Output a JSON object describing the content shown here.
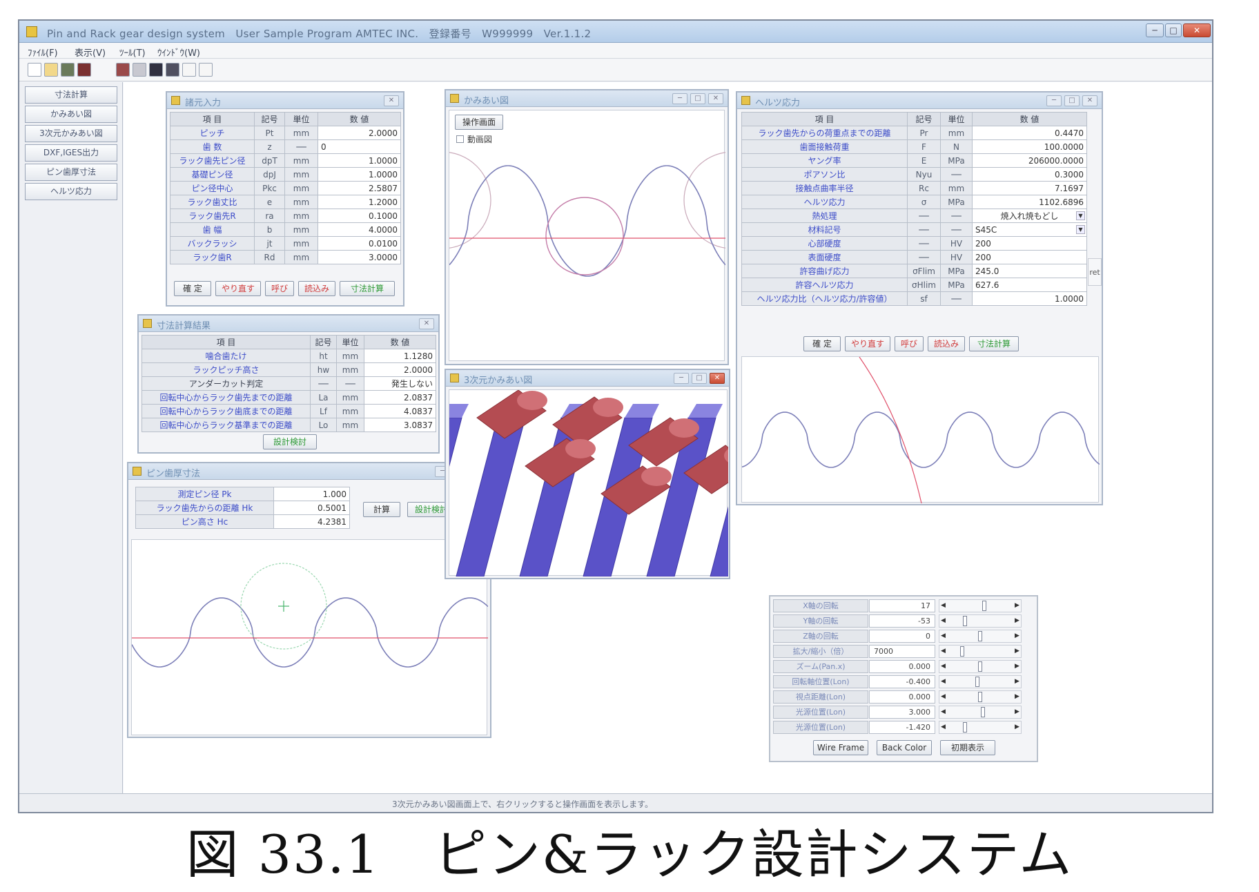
{
  "window": {
    "title": "Pin and Rack gear design system　User Sample Program AMTEC INC.　登録番号　W999999　Ver.1.1.2"
  },
  "menu": [
    "ﾌｧｲﾙ(F)",
    "表示(V)",
    "ﾂｰﾙ(T)",
    "ｳｲﾝﾄﾞｳ(W)"
  ],
  "nav_buttons": [
    "寸法計算",
    "かみあい図",
    "3次元かみあい図",
    "DXF,IGES出力",
    "ピン歯厚寸法",
    "ヘルツ応力"
  ],
  "basic_input": {
    "title": "諸元入力",
    "headers": [
      "項 目",
      "記号",
      "単位",
      "数 値"
    ],
    "rows": [
      {
        "label": "ピッチ",
        "sym": "Pt",
        "unit": "mm",
        "val": "2.0000"
      },
      {
        "label": "歯 数",
        "sym": "z",
        "unit": "──",
        "val": "0"
      },
      {
        "label": "ラック歯先ピン径",
        "sym": "dpT",
        "unit": "mm",
        "val": "1.0000"
      },
      {
        "label": "基礎ピン径",
        "sym": "dpJ",
        "unit": "mm",
        "val": "1.0000"
      },
      {
        "label": "ピン径中心",
        "sym": "Pkc",
        "unit": "mm",
        "val": "2.5807"
      },
      {
        "label": "ラック歯丈比",
        "sym": "e",
        "unit": "mm",
        "val": "1.2000"
      },
      {
        "label": "ラック歯先R",
        "sym": "ra",
        "unit": "mm",
        "val": "0.1000"
      },
      {
        "label": "歯 幅",
        "sym": "b",
        "unit": "mm",
        "val": "4.0000"
      },
      {
        "label": "バックラッシ",
        "sym": "jt",
        "unit": "mm",
        "val": "0.0100"
      },
      {
        "label": "ラック歯R",
        "sym": "Rd",
        "unit": "mm",
        "val": "3.0000"
      }
    ],
    "buttons": {
      "ok": "確 定",
      "redo": "やり直す",
      "tip": "呼び",
      "read": "読込み",
      "calc": "寸法計算"
    }
  },
  "dim_result": {
    "title": "寸法計算結果",
    "headers": [
      "項 目",
      "記号",
      "単位",
      "数 値"
    ],
    "rows": [
      {
        "label": "噛合歯たけ",
        "sym": "ht",
        "unit": "mm",
        "val": "1.1280"
      },
      {
        "label": "ラックピッチ高さ",
        "sym": "hw",
        "unit": "mm",
        "val": "2.0000"
      },
      {
        "label": "アンダーカット判定",
        "sym": "──",
        "unit": "──",
        "val": "発生しない"
      },
      {
        "label": "回転中心からラック歯先までの距離",
        "sym": "La",
        "unit": "mm",
        "val": "2.0837"
      },
      {
        "label": "回転中心からラック歯底までの距離",
        "sym": "Lf",
        "unit": "mm",
        "val": "4.0837"
      },
      {
        "label": "回転中心からラック基準までの距離",
        "sym": "Lo",
        "unit": "mm",
        "val": "3.0837"
      }
    ],
    "button": "設計検討"
  },
  "pin_dim": {
    "title": "ピン歯厚寸法",
    "rows": [
      {
        "label": "測定ピン径 Pk",
        "val": "1.000"
      },
      {
        "label": "ラック歯先からの距離 Hk",
        "val": "0.5001"
      },
      {
        "label": "ピン高さ Hc",
        "val": "4.2381"
      }
    ],
    "calc": "計算",
    "review": "設計検討"
  },
  "mesh_view": {
    "title": "かみあい図",
    "op_button": "操作画面",
    "check_label": "動画図"
  },
  "mesh3d": {
    "title": "3次元かみあい図"
  },
  "hertz": {
    "title": "ヘルツ応力",
    "headers": [
      "項 目",
      "記号",
      "単位",
      "数 値"
    ],
    "rows": [
      {
        "label": "ラック歯先からの荷重点までの距離",
        "sym": "Pr",
        "unit": "mm",
        "val": "0.4470"
      },
      {
        "label": "歯面接触荷重",
        "sym": "F",
        "unit": "N",
        "val": "100.0000"
      },
      {
        "label": "ヤング率",
        "sym": "E",
        "unit": "MPa",
        "val": "206000.0000"
      },
      {
        "label": "ポアソン比",
        "sym": "Nyu",
        "unit": "──",
        "val": "0.3000"
      },
      {
        "label": "接触点曲率半径",
        "sym": "Rc",
        "unit": "mm",
        "val": "7.1697"
      },
      {
        "label": "ヘルツ応力",
        "sym": "σ",
        "unit": "MPa",
        "val": "1102.6896"
      },
      {
        "label": "熱処理",
        "sym": "──",
        "unit": "──",
        "val": "焼入れ焼もどし",
        "dd": true
      },
      {
        "label": "材料記号",
        "sym": "──",
        "unit": "──",
        "val": "S45C",
        "dd": true
      },
      {
        "label": "心部硬度",
        "sym": "──",
        "unit": "HV",
        "val": "200"
      },
      {
        "label": "表面硬度",
        "sym": "──",
        "unit": "HV",
        "val": "200"
      },
      {
        "label": "許容曲げ応力",
        "sym": "σFlim",
        "unit": "MPa",
        "val": "245.0"
      },
      {
        "label": "許容ヘルツ応力",
        "sym": "σHlim",
        "unit": "MPa",
        "val": "627.6"
      },
      {
        "label": "ヘルツ応力比（ヘルツ応力/許容値）",
        "sym": "sf",
        "unit": "──",
        "val": "1.0000"
      }
    ],
    "side_note": "ret",
    "buttons": {
      "ok": "確 定",
      "redo": "やり直す",
      "tip": "呼び",
      "read": "読込み",
      "calc": "寸法計算"
    }
  },
  "view_ctrl": {
    "rows": [
      {
        "label": "X軸の回転",
        "val": "17"
      },
      {
        "label": "Y軸の回転",
        "val": "-53"
      },
      {
        "label": "Z軸の回転",
        "val": "0"
      },
      {
        "label": "拡大/縮小（倍）",
        "val": "7000"
      },
      {
        "label": "ズーム(Pan.x)",
        "val": "0.000"
      },
      {
        "label": "回転軸位置(Lon)",
        "val": "-0.400"
      },
      {
        "label": "視点距離(Lon)",
        "val": "0.000"
      },
      {
        "label": "光源位置(Lon)",
        "val": "3.000"
      },
      {
        "label": "光源位置(Lon)",
        "val": "-1.420"
      }
    ],
    "buttons": {
      "wire": "Wire Frame",
      "back": "Back Color",
      "init": "初期表示"
    }
  },
  "status_text": "3次元かみあい図画面上で、右クリックすると操作画面を表示します。",
  "caption": "図 33.1　ピン&ラック設計システム",
  "chart_data": [
    {
      "type": "diagram",
      "title": "かみあい図"
    },
    {
      "type": "diagram",
      "title": "ピン歯厚寸法"
    },
    {
      "type": "diagram",
      "title": "ヘルツ応力"
    }
  ]
}
